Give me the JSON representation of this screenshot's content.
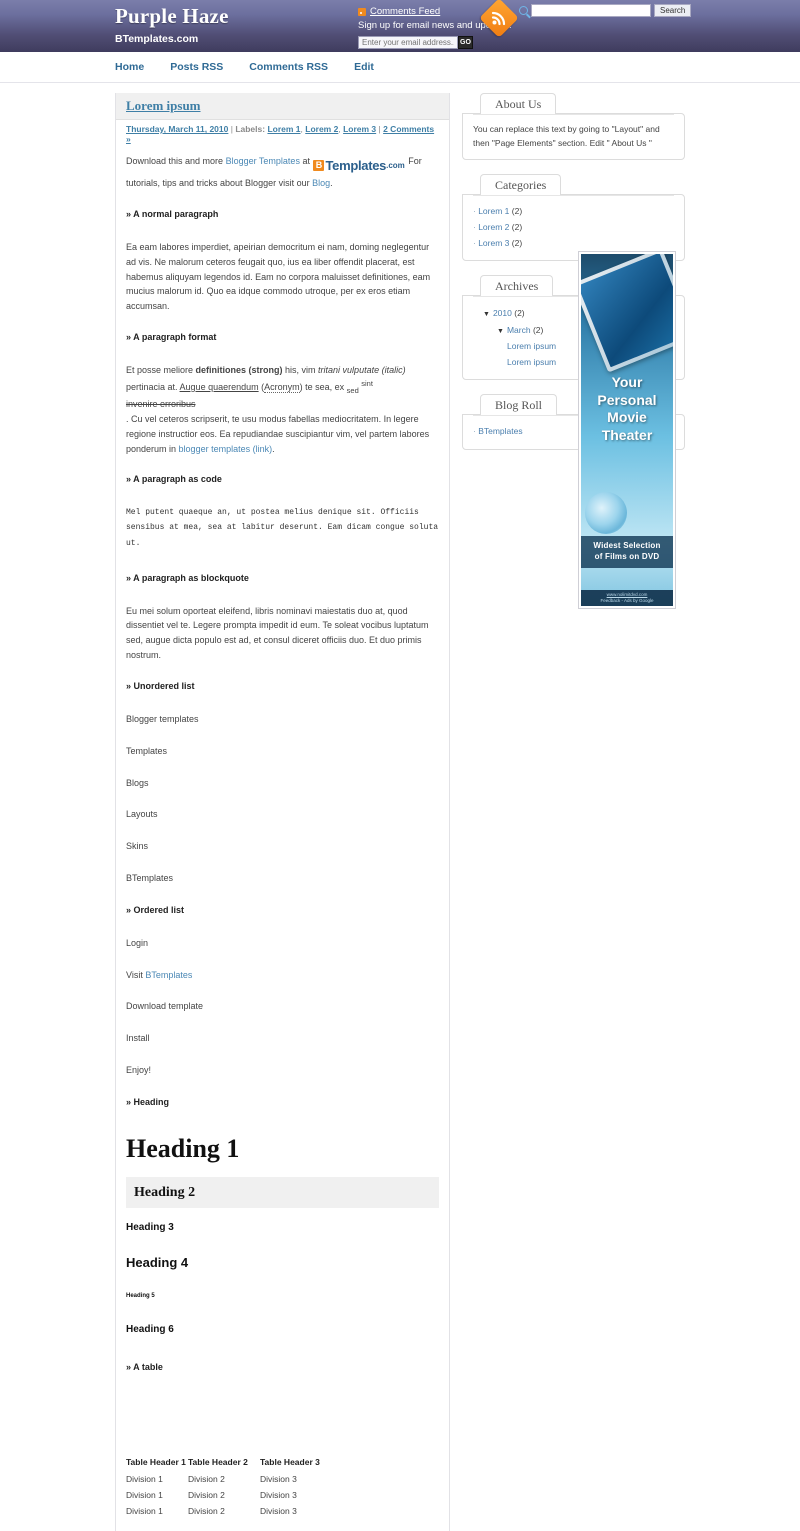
{
  "header": {
    "blog_title": "Purple Haze",
    "blog_subtitle": "BTemplates.com",
    "comments_feed_label": "Comments Feed",
    "signup_label": "Sign up for email news and updates!",
    "email_placeholder": "Enter your email address...",
    "go_label": "GO",
    "search_value": "",
    "search_button_label": "Search",
    "gradient_top": "#7b7eaa",
    "gradient_bottom": "#3f3c5e",
    "rss_color": "#f08a1e"
  },
  "nav": {
    "items": [
      {
        "label": "Home"
      },
      {
        "label": "Posts RSS"
      },
      {
        "label": "Comments RSS"
      },
      {
        "label": "Edit"
      }
    ],
    "link_color": "#2f6a95"
  },
  "post": {
    "title": "Lorem ipsum",
    "date": "Thursday, March 11, 2010",
    "labels_prefix": "Labels:",
    "labels": [
      "Lorem 1",
      "Lorem 2",
      "Lorem 3"
    ],
    "comments_link": "2 Comments »",
    "intro": {
      "before_link": "Download this and more ",
      "link1": "Blogger Templates",
      "between": " at ",
      "logo_mark": "B",
      "logo_word": "Templates",
      "logo_com": ".com",
      "after_logo": " For tutorials, tips and tricks about Blogger visit our ",
      "link2": "Blog",
      "end": "."
    },
    "sections": {
      "normal_paragraph_head": "» A normal paragraph",
      "normal_paragraph_text": "Ea eam labores imperdiet, apeirian democritum ei nam, doming neglegentur ad vis. Ne malorum ceteros feugait quo, ius ea liber offendit placerat, est habemus aliquyam legendos id. Eam no corpora maluisset definitiones, eam mucius malorum id. Quo ea idque commodo utroque, per ex eros etiam accumsan.",
      "format_head": "» A paragraph format",
      "format_p1_a": "Et posse meliore ",
      "format_strong": "definitiones (strong)",
      "format_p1_b": " his, vim ",
      "format_italic": "tritani vulputate (italic)",
      "format_p1_c": " pertinacia at. ",
      "format_underline": "Augue quaerendum",
      "format_p1_d": " (",
      "format_acronym": "Acronym",
      "format_p1_e": ") te sea, ex ",
      "format_sub": "sed",
      "format_sup": "sint",
      "format_strike": "invenire erroribus",
      "format_p2_a": ". Cu vel ceteros scripserit, te usu modus fabellas mediocritatem. In legere regione instructior eos. Ea repudiandae suscipiantur vim, vel partem labores ponderum in ",
      "format_link": "blogger templates (link)",
      "format_p2_b": ".",
      "code_head": "» A paragraph as code",
      "code_text": "Mel putent quaeque an, ut postea melius denique sit. Officiis sensibus at mea, sea at labitur deserunt. Eam dicam congue soluta ut.",
      "blockquote_head": "» A paragraph as blockquote",
      "blockquote_text": "Eu mei solum oporteat eleifend, libris nominavi maiestatis duo at, quod dissentiet vel te. Legere prompta impedit id eum. Te soleat vocibus luptatum sed, augue dicta populo est ad, et consul diceret officiis duo. Et duo primis nostrum.",
      "unordered_head": "» Unordered list",
      "unordered_items": [
        "Blogger templates",
        "Templates",
        "Blogs",
        "Layouts",
        "Skins",
        "BTemplates"
      ],
      "ordered_head": "» Ordered list",
      "ordered_items": [
        {
          "text": "Login",
          "link": ""
        },
        {
          "text": "Visit ",
          "link": "BTemplates"
        },
        {
          "text": "Download template",
          "link": ""
        },
        {
          "text": "Install",
          "link": ""
        },
        {
          "text": "Enjoy!",
          "link": ""
        }
      ],
      "heading_head": "» Heading",
      "h1": "Heading 1",
      "h2": "Heading 2",
      "h3": "Heading 3",
      "h4": "Heading 4",
      "h5": "Heading 5",
      "h6": "Heading 6",
      "table_head": "» A table"
    },
    "table": {
      "headers": [
        "Table Header 1",
        "Table Header 2",
        "Table Header 3"
      ],
      "rows": [
        [
          "Division 1",
          "Division 2",
          "Division 3"
        ],
        [
          "Division 1",
          "Division 2",
          "Division 3"
        ],
        [
          "Division 1",
          "Division 2",
          "Division 3"
        ]
      ]
    }
  },
  "sidebar": {
    "about": {
      "title": "About Us",
      "text": "You can replace this text by going to \"Layout\" and then \"Page Elements\" section. Edit \" About Us \""
    },
    "categories": {
      "title": "Categories",
      "items": [
        {
          "label": "Lorem 1",
          "count": "(2)"
        },
        {
          "label": "Lorem 2",
          "count": "(2)"
        },
        {
          "label": "Lorem 3",
          "count": "(2)"
        }
      ]
    },
    "archives": {
      "title": "Archives",
      "year": {
        "label": "2010",
        "count": "(2)",
        "marker": "▼"
      },
      "month": {
        "label": "March",
        "count": "(2)",
        "marker": "▼"
      },
      "posts": [
        "Lorem ipsum",
        "Lorem ipsum"
      ]
    },
    "blogroll": {
      "title": "Blog Roll",
      "items": [
        {
          "label": "BTemplates"
        }
      ]
    }
  },
  "ad": {
    "headline_line1": "Your",
    "headline_line2": "Personal",
    "headline_line3": "Movie",
    "headline_line4": "Theater",
    "band_line1": "Widest Selection",
    "band_line2": "of  Films on DVD",
    "url": "www.nolimitdvd.com",
    "feedback": "Feedback - Ads by Google"
  }
}
